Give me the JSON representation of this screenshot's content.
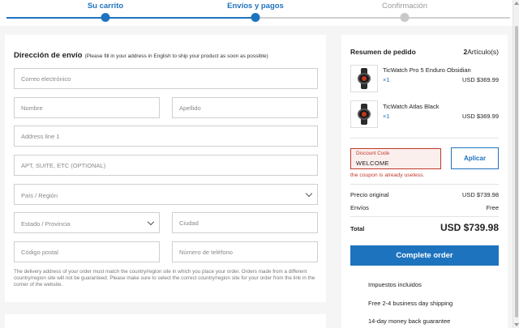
{
  "progress": {
    "steps": [
      {
        "label": "Su carrito"
      },
      {
        "label": "Envíos y pagos"
      },
      {
        "label": "Confirmación"
      }
    ]
  },
  "shipping": {
    "title": "Dirección de envío",
    "subtitle": "(Please fill in your address in English to ship your product as soon as possible)",
    "email_placeholder": "Correo electrónico",
    "first_name_placeholder": "Nombre",
    "last_name_placeholder": "Apellido",
    "address1_placeholder": "Address line 1",
    "address2_placeholder": "APT, SUITE, ETC (OPTIONAL)",
    "country_placeholder": "País / Región",
    "state_placeholder": "Estado / Provincia",
    "city_placeholder": "Ciudad",
    "zip_placeholder": "Código postal",
    "phone_placeholder": "Número de teléfono",
    "note": "The delivery address of your order must match the country/region site in which you place your order. Orders made from a different country/region site will not be guaranteed. Please make sure to select the correct country/region site for your order from the link in the corner of the website."
  },
  "summary": {
    "title": "Resumen de pedido",
    "count": "2",
    "count_label": "Artículo(s)",
    "products": [
      {
        "name": "TicWatch Pro 5 Enduro Obsidian",
        "qty": "×1",
        "price": "USD $369.99"
      },
      {
        "name": "TicWatch Atlas Black",
        "qty": "×1",
        "price": "USD $369.99"
      }
    ],
    "coupon_label": "Discount Code",
    "coupon_value": "WELCOME",
    "apply_label": "Aplicar",
    "coupon_error": "the coupon is already useless.",
    "original_label": "Precio original",
    "original_value": "USD $739.98",
    "shipping_label": "Envíos",
    "shipping_value": "Free",
    "total_label": "Total",
    "total_value": "USD $739.98",
    "complete_label": "Complete order",
    "benefits": [
      "Impuestos incluidos",
      "Free 2-4 business day shipping",
      "14-day money back guarantee"
    ]
  },
  "colors": {
    "accent": "#1e73be",
    "error": "#c0392b"
  }
}
